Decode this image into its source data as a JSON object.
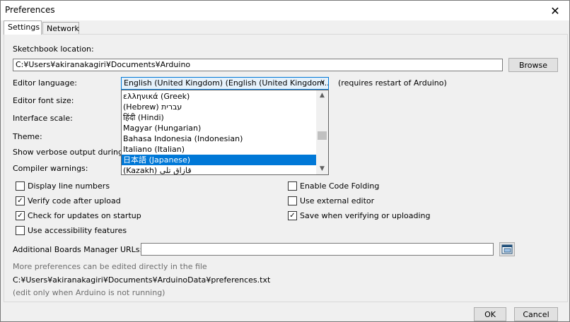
{
  "window": {
    "title": "Preferences",
    "close_glyph": "✕"
  },
  "tabs": [
    {
      "label": "Settings",
      "active": true
    },
    {
      "label": "Network",
      "active": false
    }
  ],
  "sketchbook": {
    "label": "Sketchbook location:",
    "value": "C:¥Users¥akiranakagiri¥Documents¥Arduino",
    "browse_label": "Browse"
  },
  "editor_language": {
    "label": "Editor language:",
    "selected": "English (United Kingdom) (English (United Kingdom...",
    "note": "(requires restart of Arduino)",
    "options": [
      "ελληνικά (Greek)",
      "(Hebrew) עברית",
      "हिंदी (Hindi)",
      "Magyar (Hungarian)",
      "Bahasa Indonesia (Indonesian)",
      "Italiano (Italian)",
      "日本語 (Japanese)",
      "(Kazakh) قازاق تلی"
    ],
    "highlighted_index": 6
  },
  "labels": {
    "editor_font_size": "Editor font size:",
    "interface_scale": "Interface scale:",
    "theme": "Theme:",
    "verbose_output": "Show verbose output during:",
    "compiler_warnings": "Compiler warnings:"
  },
  "checkboxes_left": [
    {
      "label": "Display line numbers",
      "checked": false
    },
    {
      "label": "Verify code after upload",
      "checked": true
    },
    {
      "label": "Check for updates on startup",
      "checked": true
    },
    {
      "label": "Use accessibility features",
      "checked": false
    }
  ],
  "checkboxes_right": [
    {
      "label": "Enable Code Folding",
      "checked": false
    },
    {
      "label": "Use external editor",
      "checked": false
    },
    {
      "label": "Save when verifying or uploading",
      "checked": true
    }
  ],
  "boards_manager": {
    "label": "Additional Boards Manager URLs:",
    "value": ""
  },
  "footer_info": {
    "more_prefs": "More preferences can be edited directly in the file",
    "prefs_path": "C:¥Users¥akiranakagiri¥Documents¥ArduinoData¥preferences.txt",
    "edit_note": "(edit only when Arduino is not running)"
  },
  "buttons": {
    "ok": "OK",
    "cancel": "Cancel"
  },
  "colors": {
    "selection": "#0078d7",
    "dialog_bg": "#f0f0f0"
  },
  "icons": {
    "check": "✓",
    "chevron_down": "∨",
    "scroll_up": "▲",
    "scroll_down": "▼"
  }
}
